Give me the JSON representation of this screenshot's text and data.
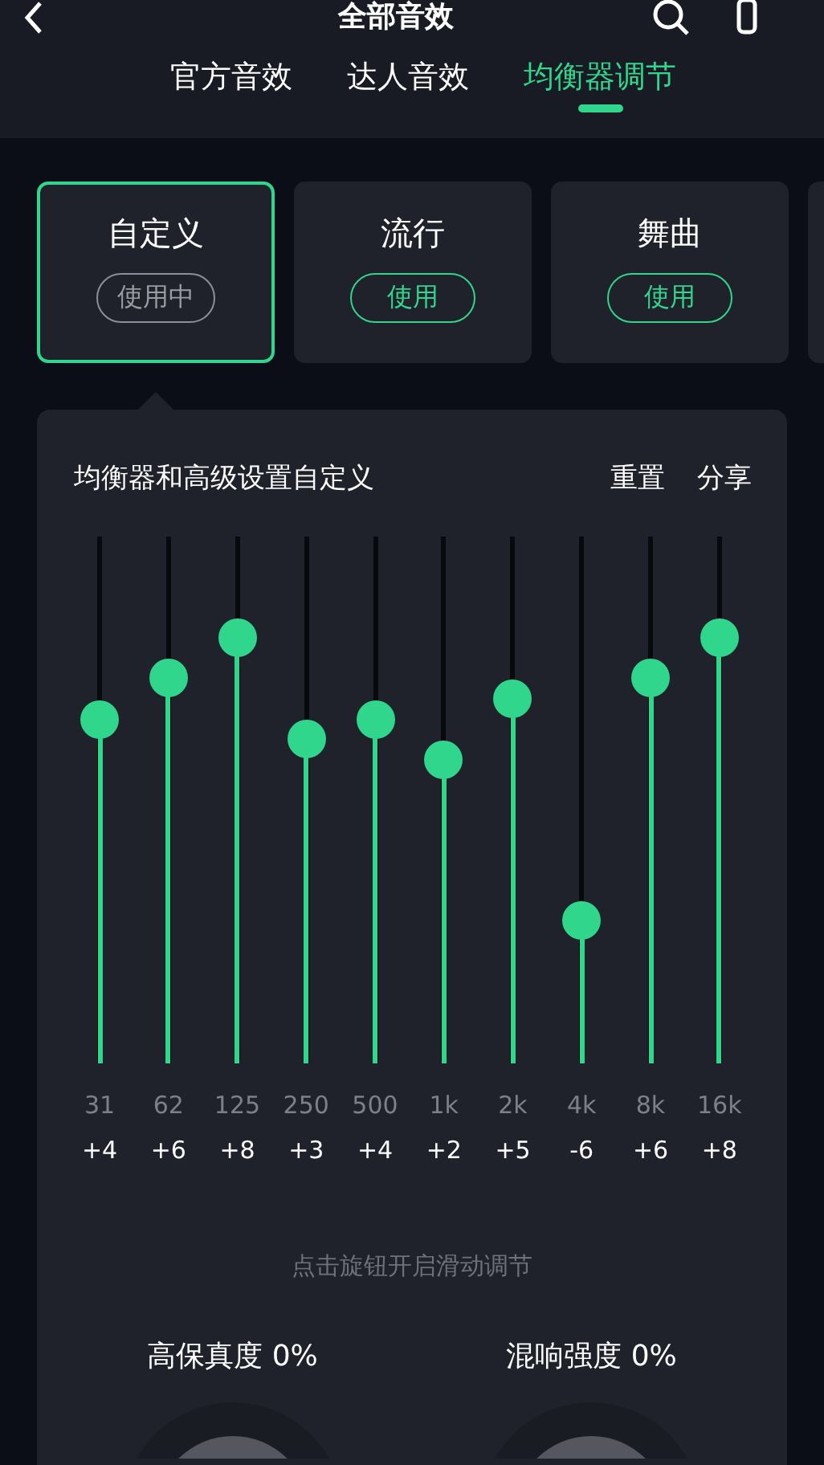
{
  "header": {
    "title": "全部音效"
  },
  "tabs": [
    {
      "label": "官方音效",
      "selected": false
    },
    {
      "label": "达人音效",
      "selected": false
    },
    {
      "label": "均衡器调节",
      "selected": true
    }
  ],
  "presets": [
    {
      "name": "自定义",
      "action": "使用中",
      "selected": true
    },
    {
      "name": "流行",
      "action": "使用",
      "selected": false
    },
    {
      "name": "舞曲",
      "action": "使用",
      "selected": false
    }
  ],
  "equalizer": {
    "title": "均衡器和高级设置自定义",
    "actions": [
      "重置",
      "分享"
    ],
    "bands": [
      {
        "freq": "31",
        "gain": "+4",
        "level": 0.652
      },
      {
        "freq": "62",
        "gain": "+6",
        "level": 0.732
      },
      {
        "freq": "125",
        "gain": "+8",
        "level": 0.808
      },
      {
        "freq": "250",
        "gain": "+3",
        "level": 0.616
      },
      {
        "freq": "500",
        "gain": "+4",
        "level": 0.652
      },
      {
        "freq": "1k",
        "gain": "+2",
        "level": 0.576
      },
      {
        "freq": "2k",
        "gain": "+5",
        "level": 0.692
      },
      {
        "freq": "4k",
        "gain": "-6",
        "level": 0.271
      },
      {
        "freq": "8k",
        "gain": "+6",
        "level": 0.732
      },
      {
        "freq": "16k",
        "gain": "+8",
        "level": 0.808
      }
    ],
    "hint": "点击旋钮开启滑动调节",
    "knobs": [
      {
        "label": "高保真度 0%"
      },
      {
        "label": "混响强度 0%"
      }
    ]
  }
}
